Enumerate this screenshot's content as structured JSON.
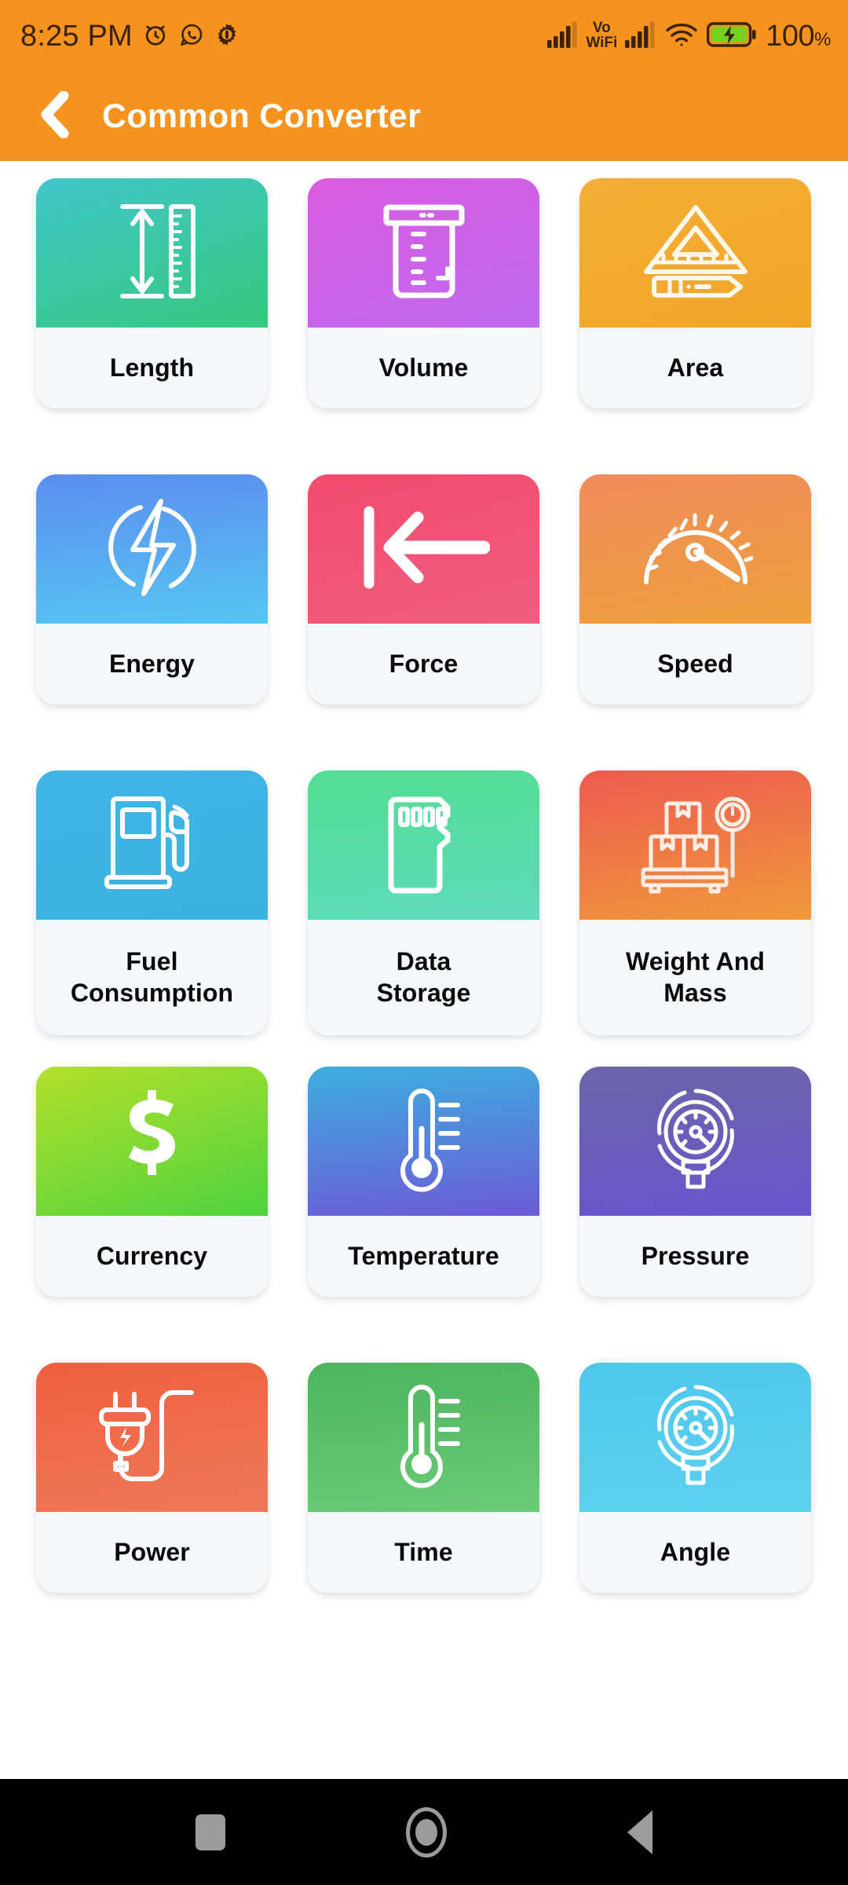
{
  "status_bar": {
    "time": "8:25 PM",
    "left_icons": [
      "alarm-icon",
      "whatsapp-icon",
      "gear-icon"
    ],
    "network_label_line1": "Vo",
    "network_label_line2": "WiFi",
    "right_icons": [
      "signal-bars-icon",
      "vowifi-icon",
      "signal-bars-icon",
      "wifi-icon",
      "battery-charging-icon"
    ],
    "battery_percent": "100",
    "percent_symbol": "%",
    "background_color": "#F6921E",
    "foreground_color": "#3A2205",
    "battery_fill_color": "#76D220"
  },
  "app_bar": {
    "back_icon": "chevron-left-icon",
    "title": "Common Converter",
    "background_color": "#F6921E",
    "title_color": "#FFFFFF"
  },
  "grid": {
    "columns": 3,
    "cards": [
      {
        "id": "length",
        "label": "Length",
        "icon": "ruler-height-icon",
        "gradient_from": "#3FC7C9",
        "gradient_to": "#35C97E"
      },
      {
        "id": "volume",
        "label": "Volume",
        "icon": "beaker-icon",
        "gradient_from": "#D95BE0",
        "gradient_to": "#C06BEF"
      },
      {
        "id": "area",
        "label": "Area",
        "icon": "triangle-ruler-pencil-icon",
        "gradient_from": "#F5AE36",
        "gradient_to": "#F0A526"
      },
      {
        "id": "energy",
        "label": "Energy",
        "icon": "lightning-circle-icon",
        "gradient_from": "#5B8DF0",
        "gradient_to": "#57C6F2"
      },
      {
        "id": "force",
        "label": "Force",
        "icon": "arrow-to-wall-icon",
        "gradient_from": "#F24B6E",
        "gradient_to": "#F05D7F"
      },
      {
        "id": "speed",
        "label": "Speed",
        "icon": "speedometer-icon",
        "gradient_from": "#F08C5C",
        "gradient_to": "#EDA03C"
      },
      {
        "id": "fuel_consumption",
        "label": "Fuel\nConsumption",
        "icon": "fuel-pump-icon",
        "gradient_from": "#3FB6E8",
        "gradient_to": "#3DB2DF"
      },
      {
        "id": "data_storage",
        "label": "Data\nStorage",
        "icon": "sd-card-icon",
        "gradient_from": "#52DE92",
        "gradient_to": "#5FD9BC"
      },
      {
        "id": "weight_and_mass",
        "label": "Weight And\nMass",
        "icon": "scale-boxes-icon",
        "gradient_from": "#EE5A50",
        "gradient_to": "#EF9A3B"
      },
      {
        "id": "currency",
        "label": "Currency",
        "icon": "dollar-sign-icon",
        "gradient_from": "#B4E02A",
        "gradient_to": "#4ED33F"
      },
      {
        "id": "temperature",
        "label": "Temperature",
        "icon": "thermometer-icon",
        "gradient_from": "#3DAEE0",
        "gradient_to": "#6C5BD6"
      },
      {
        "id": "pressure",
        "label": "Pressure",
        "icon": "pressure-gauge-icon",
        "gradient_from": "#6A66A8",
        "gradient_to": "#6A54CE"
      },
      {
        "id": "power",
        "label": "Power",
        "icon": "power-plug-icon",
        "gradient_from": "#EE5F3C",
        "gradient_to": "#EE7A5B"
      },
      {
        "id": "time",
        "label": "Time",
        "icon": "thermometer-icon",
        "gradient_from": "#4DB45E",
        "gradient_to": "#6BCB78"
      },
      {
        "id": "angle",
        "label": "Angle",
        "icon": "pressure-gauge-icon",
        "gradient_from": "#4DC7ED",
        "gradient_to": "#5FD1EF"
      }
    ],
    "card_background": "#F5F8FC",
    "label_color": "#0A0A0A"
  },
  "nav_bar": {
    "background_color": "#000000",
    "icon_color": "#9B9B9B",
    "buttons": [
      {
        "id": "recents",
        "icon": "recents-square-icon"
      },
      {
        "id": "home",
        "icon": "home-circle-icon"
      },
      {
        "id": "back",
        "icon": "back-triangle-icon"
      }
    ]
  }
}
